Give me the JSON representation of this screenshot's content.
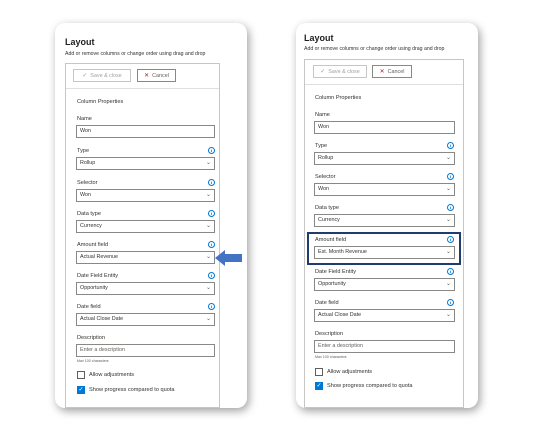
{
  "left": {
    "title": "Layout",
    "subtitle": "Add or remove columns or change order using drag and drop",
    "save_label": "Save & close",
    "cancel_label": "Cancel",
    "section_title": "Column Properties",
    "name_label": "Name",
    "name_value": "Won",
    "type_label": "Type",
    "type_value": "Rollup",
    "selector_label": "Selector",
    "selector_value": "Won",
    "datatype_label": "Data type",
    "datatype_value": "Currency",
    "amount_label": "Amount field",
    "amount_value": "Actual Revenue",
    "entity_label": "Date Field Entity",
    "entity_value": "Opportunity",
    "datefield_label": "Date field",
    "datefield_value": "Actual Close Date",
    "description_label": "Description",
    "description_placeholder": "Enter a description",
    "max_hint": "Max 100 characters",
    "allow_label": "Allow adjustments",
    "progress_label": "Show progress compared to quota"
  },
  "right": {
    "title": "Layout",
    "subtitle": "Add or remove columns or change order using drag and drop",
    "save_label": "Save & close",
    "cancel_label": "Cancel",
    "section_title": "Column Properties",
    "name_label": "Name",
    "name_value": "Won",
    "type_label": "Type",
    "type_value": "Rollup",
    "selector_label": "Selector",
    "selector_value": "Won",
    "datatype_label": "Data type",
    "datatype_value": "Currency",
    "amount_label": "Amount field",
    "amount_value": "Est. Month Revenue",
    "entity_label": "Date Field Entity",
    "entity_value": "Opportunity",
    "datefield_label": "Date field",
    "datefield_value": "Actual Close Date",
    "description_label": "Description",
    "description_placeholder": "Enter a description",
    "max_hint": "Max 100 characters",
    "allow_label": "Allow adjustments",
    "progress_label": "Show progress compared to quota"
  },
  "icons": {
    "check": "✓",
    "close": "✕",
    "chevron": "⌄",
    "info": "i"
  },
  "colors": {
    "accent": "#0078d4",
    "highlight_border": "#1f3c6e",
    "arrow": "#4472c4"
  }
}
